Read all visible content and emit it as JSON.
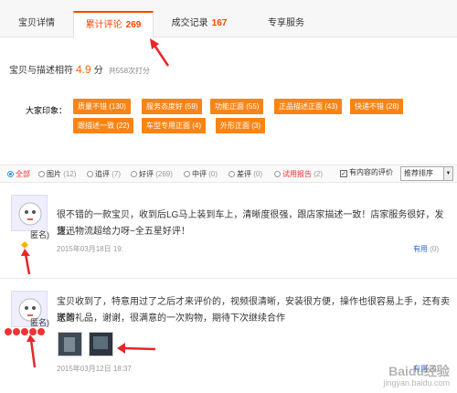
{
  "tabs": [
    {
      "label": "宝贝详情",
      "count": ""
    },
    {
      "label": "累计评论",
      "count": "269"
    },
    {
      "label": "成交记录",
      "count": "167"
    },
    {
      "label": "专享服务",
      "count": ""
    }
  ],
  "rating": {
    "label": "宝贝与描述相符",
    "score": "4.9",
    "unit": "分",
    "times": "共558次打分"
  },
  "impressions": {
    "label": "大家印象：",
    "tags": [
      "质量不错 (130)",
      "服务态度好 (59)",
      "功能正面 (55)",
      "正品描述正面 (43)",
      "快递不错 (28)",
      "跟描述一致 (22)",
      "车型专用正面 (4)",
      "外形正面 (3)"
    ]
  },
  "filters": {
    "options": [
      {
        "label": "全部",
        "num": ""
      },
      {
        "label": "图片",
        "num": "(12)"
      },
      {
        "label": "追评",
        "num": "(7)"
      },
      {
        "label": "好评",
        "num": "(269)"
      },
      {
        "label": "中评",
        "num": "(0)"
      },
      {
        "label": "差评",
        "num": "(0)"
      },
      {
        "label": "试用报告",
        "num": "(2)"
      }
    ],
    "only_content": "有内容的评价",
    "sort": "推荐排序"
  },
  "reviews": [
    {
      "user": "匿名)",
      "text1": "很不错的一款宝贝，收到后LG马上装到车上，清晰度很强，跟店家描述一致！店家服务很好，发货迅",
      "text2": "速，物流超给力呀~全五星好评！",
      "date": "2015年03月18日 19:",
      "useful": "有用",
      "useful_n": "(0)"
    },
    {
      "user": "匿名)",
      "text1": "宝贝收到了，特意用过了之后才来评价的，视频很清晰，安装很方便，操作也很容易上手，还有卖家赠",
      "text2": "送的礼品，谢谢，很满意的一次购物，期待下次继续合作",
      "date": "2015年03月12日 18:37",
      "useful": "有用",
      "useful_n": "(0)"
    }
  ],
  "watermark": {
    "line1": "Baidu经验",
    "line2": "jingyan.baidu.com"
  }
}
